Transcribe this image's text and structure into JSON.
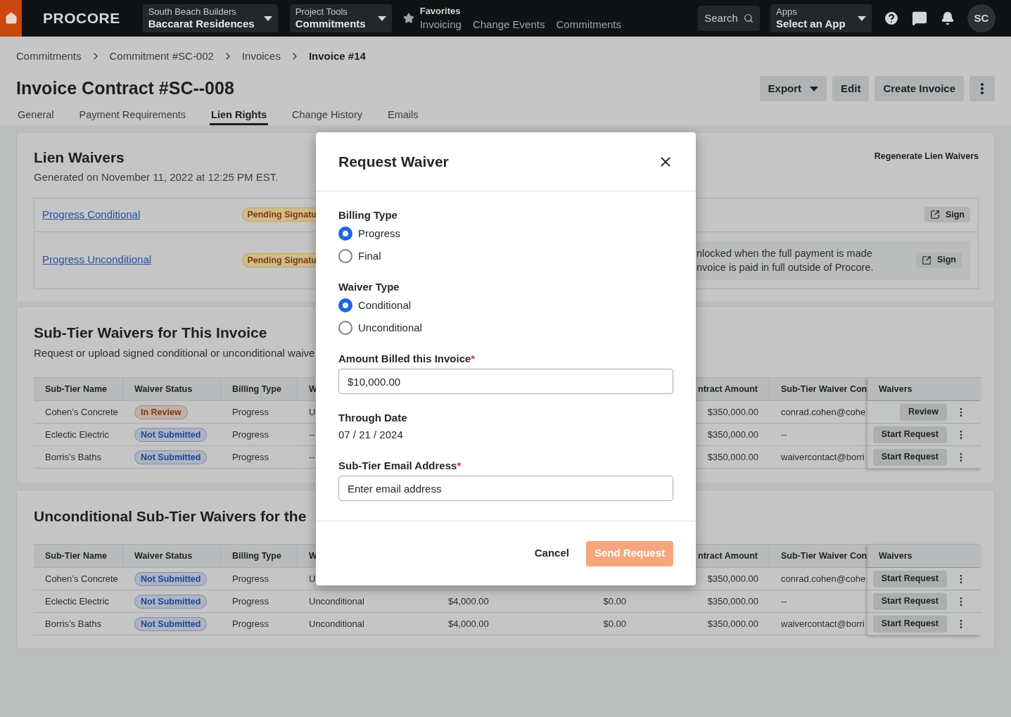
{
  "nav": {
    "logo": "PROCORE",
    "company": {
      "label": "South Beach Builders",
      "value": "Baccarat Residences"
    },
    "tool": {
      "label": "Project Tools",
      "value": "Commitments"
    },
    "favorites": {
      "label": "Favorites",
      "items": [
        "Invoicing",
        "Change Events",
        "Commitments"
      ]
    },
    "search": {
      "placeholder": "Search"
    },
    "apps": {
      "label": "Apps",
      "value": "Select an App"
    },
    "avatar": "SC"
  },
  "breadcrumbs": [
    {
      "label": "Commitments",
      "current": false
    },
    {
      "label": "Commitment #SC-002",
      "current": false
    },
    {
      "label": "Invoices",
      "current": false
    },
    {
      "label": "Invoice #14",
      "current": true
    }
  ],
  "page_title": "Invoice Contract #SC--008",
  "actions": [
    {
      "kind": "dropdown",
      "label": "Export"
    },
    {
      "kind": "plain",
      "label": "Edit"
    },
    {
      "kind": "plain",
      "label": "Create Invoice"
    },
    {
      "kind": "more"
    }
  ],
  "tabs": [
    {
      "label": "General",
      "selected": false
    },
    {
      "label": "Payment Requirements",
      "selected": false
    },
    {
      "label": "Lien Rights",
      "selected": true
    },
    {
      "label": "Change History",
      "selected": false
    },
    {
      "label": "Emails",
      "selected": false
    }
  ],
  "lien_waivers": {
    "title": "Lien Waivers",
    "subtitle": "Generated on November 11, 2022 at 12:25 PM EST.",
    "regenerate": "Regenerate Lien Waivers",
    "rows": [
      {
        "link": "Progress Conditional",
        "status": "Pending Signatu",
        "action": "Sign"
      },
      {
        "link": "Progress Unconditional",
        "status": "Pending Signatu",
        "note": [
          "nlocked when the full payment is made",
          "nvoice is paid in full outside of Procore."
        ],
        "action": "Sign"
      }
    ]
  },
  "sections": [
    {
      "title": "Sub-Tier Waivers for This Invoice",
      "description": "Request or upload signed conditional or unconditional waive",
      "columns": {
        "name": "Sub-Tier Name",
        "status": "Waiver Status",
        "billing": "Billing Type",
        "column_4": "W",
        "contract": "ntract Amount",
        "contact": "Sub-Tier Waiver Con",
        "waivers": "Waivers"
      },
      "rows": [
        {
          "name": "Cohen’s Concrete",
          "status": {
            "label": "In Review",
            "color": "#8a3608"
          },
          "billing": "Progress",
          "column_4": "U",
          "contract": "$350,000.00",
          "contact": "conrad.cohen@cohe",
          "action": "Review"
        },
        {
          "name": "Eclectic Electric",
          "status": {
            "label": "Not Submitted",
            "color": "#1c479c"
          },
          "billing": "Progress",
          "column_4": "--",
          "contract": "$350,000.00",
          "contact": "--",
          "action": "Start Request"
        },
        {
          "name": "Borris’s Baths",
          "status": {
            "label": "Not Submitted",
            "color": "#1c479c"
          },
          "billing": "Progress",
          "column_4": "--",
          "contract": "$350,000.00",
          "contact": "waivercontact@borri",
          "action": "Start Request"
        }
      ]
    },
    {
      "title": "Unconditional Sub-Tier Waivers for the",
      "columns": {
        "name": "Sub-Tier Name",
        "status": "Waiver Status",
        "billing": "Billing Type",
        "column_4": "W",
        "contract": "ntract Amount",
        "contact": "Sub-Tier Waiver Con",
        "waivers": "Waivers"
      },
      "rows": [
        {
          "name": "Cohen’s Concrete",
          "status": {
            "label": "Not Submitted",
            "color": "#1c479c"
          },
          "billing": "Progress",
          "column_4": "U",
          "contract": "$350,000.00",
          "contact": "conrad.cohen@cohe",
          "action": "Start Request"
        },
        {
          "name": "Eclectic Electric",
          "status": {
            "label": "Not Submitted",
            "color": "#1c479c"
          },
          "billing": "Progress",
          "column_4": "Unconditional",
          "column_5": "$4,000.00",
          "column_6": "$0.00",
          "contract": "$350,000.00",
          "contact": "--",
          "action": "Start Request"
        },
        {
          "name": "Borris’s Baths",
          "status": {
            "label": "Not Submitted",
            "color": "#1c479c"
          },
          "billing": "Progress",
          "column_4": "Unconditional",
          "column_5": "$4,000.00",
          "column_6": "$0.00",
          "contract": "$350,000.00",
          "contact": "waivercontact@borri",
          "action": "Start Request"
        }
      ]
    }
  ],
  "modal": {
    "title": "Request Waiver",
    "groups": [
      {
        "kind": "radio",
        "label": "Billing Type",
        "options": [
          {
            "label": "Progress",
            "selected": true
          },
          {
            "label": "Final",
            "selected": false
          }
        ]
      },
      {
        "kind": "radio",
        "label": "Waiver Type",
        "options": [
          {
            "label": "Conditional",
            "selected": true
          },
          {
            "label": "Unconditional",
            "selected": false
          }
        ]
      },
      {
        "kind": "input",
        "label": "Amount Billed this Invoice",
        "required_mark": "*",
        "value": "$10,000.00"
      },
      {
        "kind": "text",
        "label": "Through Date",
        "value": "07 / 21 / 2024"
      },
      {
        "kind": "input",
        "label": "Sub-Tier Email Address",
        "required_mark": "*",
        "placeholder": "Enter email address"
      }
    ],
    "buttons": [
      {
        "kind": "secondary",
        "label": "Cancel",
        "disabled": false
      },
      {
        "kind": "primary",
        "label": "Send Request",
        "disabled": true
      }
    ]
  }
}
